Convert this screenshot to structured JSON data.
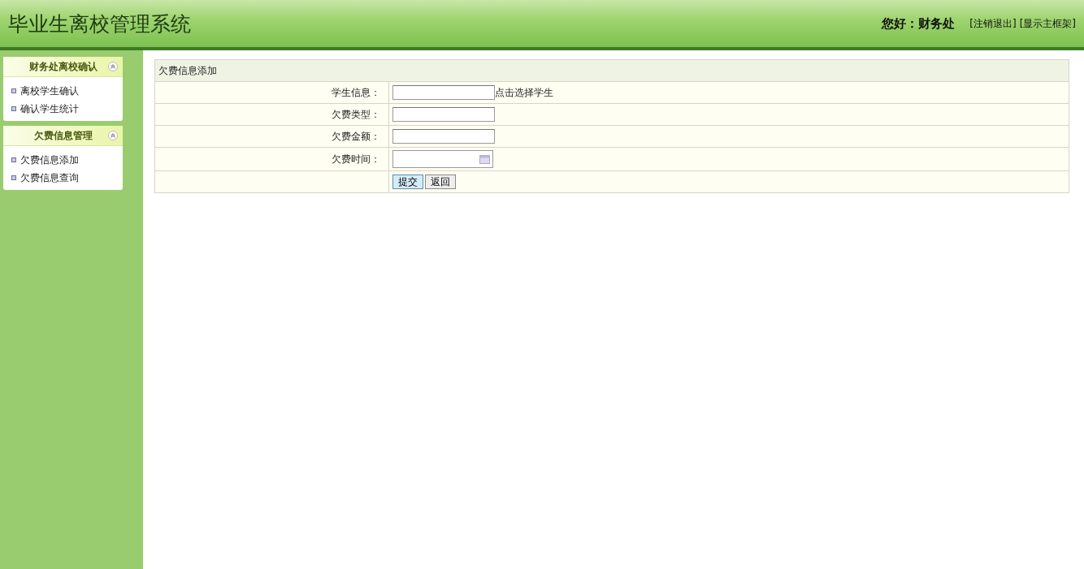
{
  "header": {
    "title": "毕业生离校管理系统",
    "greeting": "您好：财务处",
    "links": [
      "[注销退出]",
      "[显示主框架]"
    ]
  },
  "sidebar": {
    "groups": [
      {
        "title": "财务处离校确认",
        "expanded": true,
        "items": [
          "离校学生确认",
          "确认学生统计"
        ]
      },
      {
        "title": "欠费信息管理",
        "expanded": true,
        "items": [
          "欠费信息添加",
          "欠费信息查询"
        ]
      }
    ]
  },
  "form": {
    "title": "欠费信息添加",
    "fields": [
      {
        "label": "学生信息：",
        "kind": "picker",
        "link": "点击选择学生"
      },
      {
        "label": "欠费类型：",
        "kind": "text"
      },
      {
        "label": "欠费金额：",
        "kind": "text"
      },
      {
        "label": "欠费时间：",
        "kind": "date"
      }
    ],
    "buttons": [
      {
        "label": "提交",
        "kind": "submit"
      },
      {
        "label": "返回",
        "kind": "plain"
      }
    ]
  }
}
